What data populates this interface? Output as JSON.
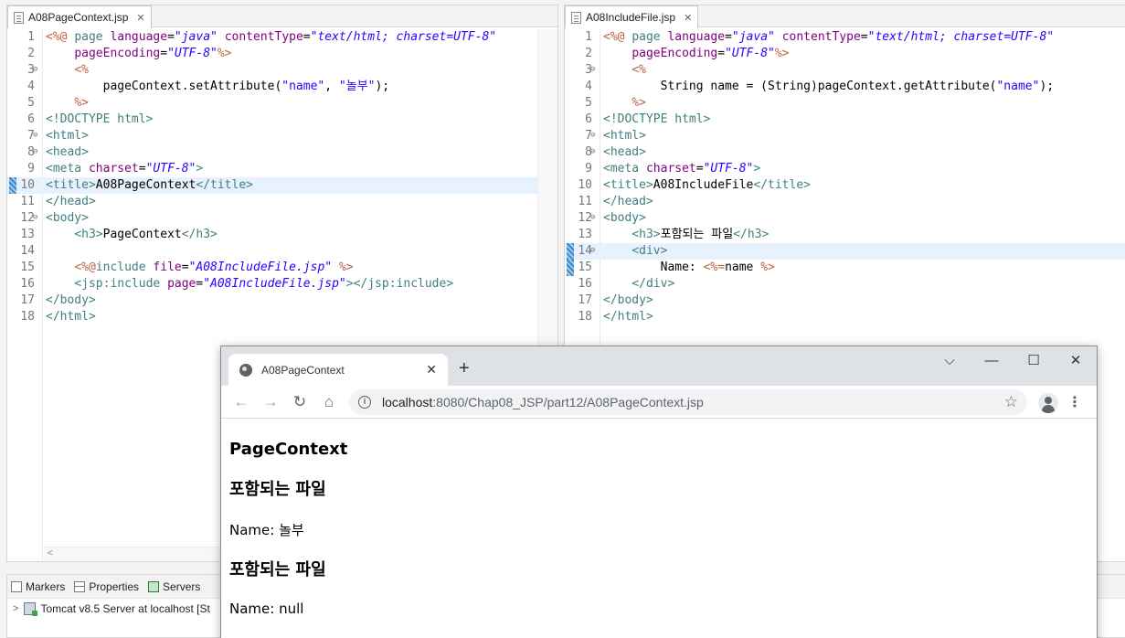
{
  "editor_left": {
    "tab_label": "A08PageContext.jsp",
    "h_scroll_glyph": "<",
    "lines": [
      {
        "n": "1",
        "html": "<span class='t-dir'>&lt;%@</span> <span class='t-kw'>page</span> <span class='t-attr'>language</span>=<span class='t-str'>\"java\"</span> <span class='t-attr'>contentType</span>=<span class='t-str'>\"text/html; charset=UTF-8\"</span>"
      },
      {
        "n": "2",
        "html": "    <span class='t-attr'>pageEncoding</span>=<span class='t-str'>\"UTF-8\"</span><span class='t-dir'>%&gt;</span>"
      },
      {
        "n": "3",
        "fold": true,
        "html": "    <span class='t-dir'>&lt;%</span>"
      },
      {
        "n": "4",
        "html": "        pageContext.setAttribute(<span class='t-jstr'>\"name\"</span>, <span class='t-jstr'>\"놀부\"</span>);"
      },
      {
        "n": "5",
        "html": "    <span class='t-dir'>%&gt;</span>"
      },
      {
        "n": "6",
        "html": "<span class='t-tag'>&lt;!DOCTYPE</span> <span class='t-kw'>html</span><span class='t-tag'>&gt;</span>"
      },
      {
        "n": "7",
        "fold": true,
        "html": "<span class='t-tag'>&lt;html&gt;</span>"
      },
      {
        "n": "8",
        "fold": true,
        "html": "<span class='t-tag'>&lt;head&gt;</span>"
      },
      {
        "n": "9",
        "html": "<span class='t-tag'>&lt;meta</span> <span class='t-attr'>charset</span>=<span class='t-str'>\"UTF-8\"</span><span class='t-tag'>&gt;</span>"
      },
      {
        "n": "10",
        "hl": true,
        "mark": true,
        "html": "<span class='t-tag'>&lt;title&gt;</span>A08PageContext<span class='t-tag'>&lt;/title&gt;</span>"
      },
      {
        "n": "11",
        "html": "<span class='t-tag'>&lt;/head&gt;</span>"
      },
      {
        "n": "12",
        "fold": true,
        "html": "<span class='t-tag'>&lt;body&gt;</span>"
      },
      {
        "n": "13",
        "html": "    <span class='t-tag'>&lt;h3&gt;</span>PageContext<span class='t-tag'>&lt;/h3&gt;</span>"
      },
      {
        "n": "14",
        "html": ""
      },
      {
        "n": "15",
        "html": "    <span class='t-dir'>&lt;%@</span><span class='t-kw'>include</span> <span class='t-attr'>file</span>=<span class='t-str'>\"A08IncludeFile.jsp\"</span> <span class='t-dir'>%&gt;</span>"
      },
      {
        "n": "16",
        "html": "    <span class='t-tag'>&lt;jsp:include</span> <span class='t-attr'>page</span>=<span class='t-str'>\"A08IncludeFile.jsp\"</span><span class='t-tag'>&gt;&lt;/jsp:include&gt;</span>"
      },
      {
        "n": "17",
        "html": "<span class='t-tag'>&lt;/body&gt;</span>"
      },
      {
        "n": "18",
        "html": "<span class='t-tag'>&lt;/html&gt;</span>"
      }
    ]
  },
  "editor_right": {
    "tab_label": "A08IncludeFile.jsp",
    "lines": [
      {
        "n": "1",
        "html": "<span class='t-dir'>&lt;%@</span> <span class='t-kw'>page</span> <span class='t-attr'>language</span>=<span class='t-str'>\"java\"</span> <span class='t-attr'>contentType</span>=<span class='t-str'>\"text/html; charset=UTF-8\"</span>"
      },
      {
        "n": "2",
        "html": "    <span class='t-attr'>pageEncoding</span>=<span class='t-str'>\"UTF-8\"</span><span class='t-dir'>%&gt;</span>"
      },
      {
        "n": "3",
        "fold": true,
        "html": "    <span class='t-dir'>&lt;%</span>"
      },
      {
        "n": "4",
        "html": "        String name = (String)pageContext.getAttribute(<span class='t-jstr'>\"name\"</span>);"
      },
      {
        "n": "5",
        "html": "    <span class='t-dir'>%&gt;</span>"
      },
      {
        "n": "6",
        "html": "<span class='t-tag'>&lt;!DOCTYPE</span> <span class='t-kw'>html</span><span class='t-tag'>&gt;</span>"
      },
      {
        "n": "7",
        "fold": true,
        "html": "<span class='t-tag'>&lt;html&gt;</span>"
      },
      {
        "n": "8",
        "fold": true,
        "html": "<span class='t-tag'>&lt;head&gt;</span>"
      },
      {
        "n": "9",
        "html": "<span class='t-tag'>&lt;meta</span> <span class='t-attr'>charset</span>=<span class='t-str'>\"UTF-8\"</span><span class='t-tag'>&gt;</span>"
      },
      {
        "n": "10",
        "html": "<span class='t-tag'>&lt;title&gt;</span>A08IncludeFile<span class='t-tag'>&lt;/title&gt;</span>"
      },
      {
        "n": "11",
        "html": "<span class='t-tag'>&lt;/head&gt;</span>"
      },
      {
        "n": "12",
        "fold": true,
        "html": "<span class='t-tag'>&lt;body&gt;</span>"
      },
      {
        "n": "13",
        "html": "    <span class='t-tag'>&lt;h3&gt;</span>포함되는 파일<span class='t-tag'>&lt;/h3&gt;</span>"
      },
      {
        "n": "14",
        "hl": true,
        "mark": true,
        "fold": true,
        "html": "    <span class='t-tag'>&lt;div&gt;</span>"
      },
      {
        "n": "15",
        "mark": true,
        "html": "        Name: <span class='t-dir'>&lt;%=</span>name <span class='t-dir'>%&gt;</span>"
      },
      {
        "n": "16",
        "html": "    <span class='t-tag'>&lt;/div&gt;</span>"
      },
      {
        "n": "17",
        "html": "<span class='t-tag'>&lt;/body&gt;</span>"
      },
      {
        "n": "18",
        "html": "<span class='t-tag'>&lt;/html&gt;</span>"
      }
    ]
  },
  "bottom_panel": {
    "tabs": [
      "Markers",
      "Properties",
      "Servers"
    ],
    "server_entry": "Tomcat v8.5 Server at localhost  [St"
  },
  "browser": {
    "tab_title": "A08PageContext",
    "tab_close": "✕",
    "new_tab": "+",
    "controls": {
      "dropdown": "⌵",
      "minimize": "—",
      "maximize": "☐",
      "close": "✕"
    },
    "nav": {
      "back": "←",
      "forward": "→",
      "reload": "↻",
      "home": "⌂"
    },
    "url_host": "localhost",
    "url_path": ":8080/Chap08_JSP/part12/A08PageContext.jsp",
    "star": "☆",
    "menu": "⋮",
    "content": {
      "heading1": "PageContext",
      "heading2": "포함되는 파일",
      "name_line1": "Name: 놀부",
      "heading3": "포함되는 파일",
      "name_line2": "Name: null"
    }
  }
}
